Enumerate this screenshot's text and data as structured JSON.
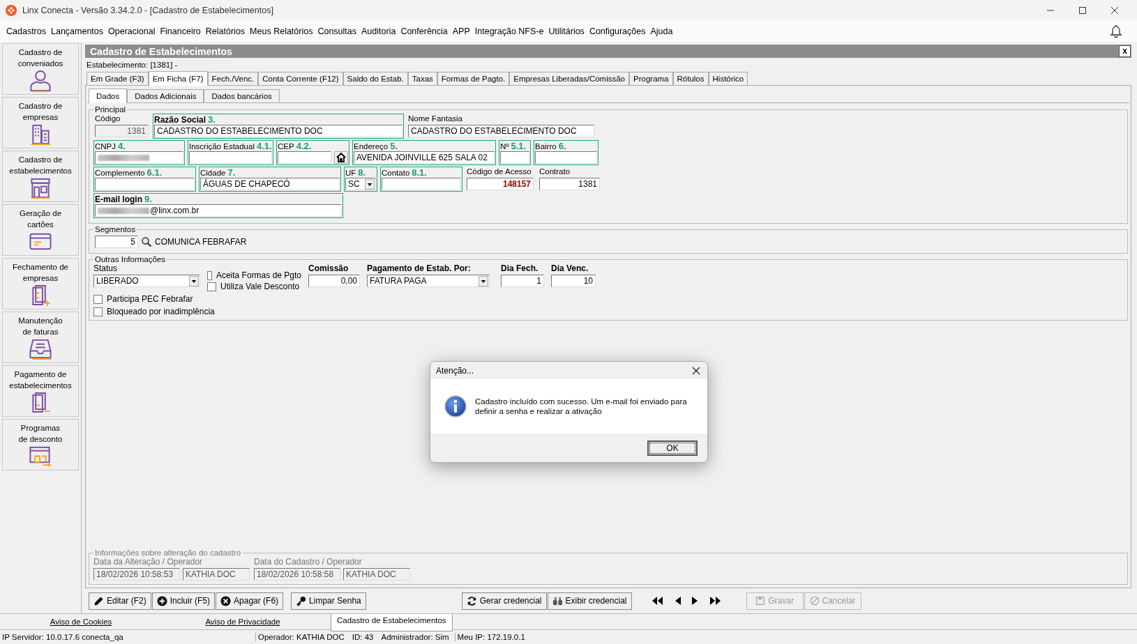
{
  "window": {
    "title": "Linx Conecta - Versão 3.34.2.0 - [Cadastro de Estabelecimentos]"
  },
  "menu": [
    "Cadastros",
    "Lançamentos",
    "Operacional",
    "Financeiro",
    "Relatórios",
    "Meus Relatórios",
    "Consultas",
    "Auditoria",
    "Conferência",
    "APP",
    "Integração NFS-e",
    "Utilitários",
    "Configurações",
    "Ajuda"
  ],
  "sidebar": {
    "items": [
      {
        "label": "Cadastro de\nconveniados",
        "selected": false
      },
      {
        "label": "Cadastro de\nempresas",
        "selected": false
      },
      {
        "label": "Cadastro de\nestabelecimentos",
        "selected": false
      },
      {
        "label": "Geração de\ncartões",
        "selected": false
      },
      {
        "label": "Fechamento de\nempresas",
        "selected": false
      },
      {
        "label": "Manutenção\nde faturas",
        "selected": false
      },
      {
        "label": "Pagamento de\nestabelecimentos",
        "selected": false
      },
      {
        "label": "Programas\nde desconto",
        "selected": false
      }
    ]
  },
  "panel": {
    "title": "Cadastro de Estabelecimentos",
    "close": "x",
    "record": "Estabelecimento: [1381] -"
  },
  "tabs": [
    {
      "label": "Em Grade (F3)",
      "selected": false
    },
    {
      "label": "Em Ficha (F7)",
      "selected": true
    },
    {
      "label": "Fech./Venc.",
      "selected": false
    },
    {
      "label": "Conta Corrente (F12)",
      "selected": false
    },
    {
      "label": "Saldo do Estab.",
      "selected": false
    },
    {
      "label": "Taxas",
      "selected": false
    },
    {
      "label": "Formas de Pagto.",
      "selected": false
    },
    {
      "label": "Empresas Liberadas/Comissão",
      "selected": false
    },
    {
      "label": "Programa",
      "selected": false
    },
    {
      "label": "Rótulos",
      "selected": false
    },
    {
      "label": "Histórico",
      "selected": false
    }
  ],
  "subtabs": [
    {
      "label": "Dados",
      "selected": true
    },
    {
      "label": "Dados Adicionais",
      "selected": false
    },
    {
      "label": "Dados bancários",
      "selected": false
    }
  ],
  "principal": {
    "title": "Principal",
    "lines": [
      {
        "fields": [
          {
            "label": "Código",
            "kind": "number",
            "value": "1381",
            "readonly": true,
            "highlighted": false
          },
          {
            "label": "Razão Social",
            "marker": "3.",
            "kind": "text",
            "value": "CADASTRO DO ESTABELECIMENTO DOC",
            "highlighted": true,
            "bold": true
          },
          {
            "label": "Nome Fantasia",
            "kind": "text",
            "value": "CADASTRO DO ESTABELECIMENTO DOC",
            "highlighted": false
          }
        ]
      },
      {
        "fields": [
          {
            "label": "CNPJ",
            "marker": "4.",
            "kind": "text",
            "redacted": true,
            "highlighted": true
          },
          {
            "label": "Inscrição Estadual",
            "marker": "4.1.",
            "kind": "text",
            "highlighted": true
          },
          {
            "label": "CEP",
            "marker": "4.2.",
            "kind": "lookup",
            "highlighted": true
          },
          {
            "label": "Endereço",
            "marker": "5.",
            "kind": "text",
            "value": "AVENIDA JOINVILLE 625 SALA 02",
            "highlighted": true
          },
          {
            "label": "Nº",
            "marker": "5.1.",
            "kind": "text",
            "highlighted": true
          },
          {
            "label": "Bairro",
            "marker": "6.",
            "kind": "text",
            "highlighted": true
          }
        ]
      },
      {
        "fields": [
          {
            "label": "Complemento",
            "marker": "6.1.",
            "kind": "text",
            "highlighted": true
          },
          {
            "label": "Cidade",
            "marker": "7.",
            "kind": "text",
            "value": "ÁGUAS DE CHAPECÓ",
            "highlighted": true
          },
          {
            "label": "UF",
            "marker": "8.",
            "kind": "select",
            "value": "SC",
            "highlighted": true
          },
          {
            "label": "Contato",
            "marker": "8.1.",
            "kind": "text",
            "highlighted": true
          },
          {
            "label": "Código de Acesso",
            "kind": "code",
            "value": "148157",
            "highlighted": false
          },
          {
            "label": "Contrato",
            "kind": "number",
            "value": "1381",
            "highlighted": false
          }
        ]
      },
      {
        "fields": [
          {
            "label": "E-mail login",
            "marker": "9.",
            "kind": "text",
            "value": "@linx.com.br",
            "redacted": true,
            "highlighted": true,
            "bold": true
          }
        ]
      }
    ]
  },
  "segmentos": {
    "title": "Segmentos",
    "code": "5",
    "name": "COMUNICA FEBRAFAR"
  },
  "outras": {
    "title": "Outras Informações",
    "status": {
      "label": "Status",
      "value": "LIBERADO"
    },
    "checkboxes": [
      {
        "label": "Aceita Formas de Pgto",
        "checked": false
      },
      {
        "label": "Utiliza Vale Desconto",
        "checked": false
      }
    ],
    "comissao": {
      "label": "Comissão",
      "value": "0,00"
    },
    "pagamento": {
      "label": "Pagamento de Estab. Por:",
      "value": "FATURA PAGA"
    },
    "dia_fech": {
      "label": "Dia Fech.",
      "value": "1"
    },
    "dia_venc": {
      "label": "Dia Venc.",
      "value": "10"
    },
    "flags": [
      {
        "label": "Participa PEC Febrafar",
        "checked": false
      },
      {
        "label": "Bloqueado por inadimplência",
        "checked": false
      }
    ]
  },
  "alteracao": {
    "title": "Informações sobre alteração do cadastro",
    "groups": [
      {
        "label": "Data da Alteração / Operador",
        "date": "18/02/2026 10:58:53",
        "operator": "KATHIA DOC"
      },
      {
        "label": "Data do Cadastro / Operador",
        "date": "18/02/2026 10:58:58",
        "operator": "KATHIA DOC"
      }
    ]
  },
  "buttons_left": [
    {
      "label": "Editar (F2)",
      "disabled": false
    },
    {
      "label": "Incluir (F5)",
      "disabled": false
    },
    {
      "label": "Apagar (F6)",
      "disabled": false
    },
    {
      "label": "Limpar Senha",
      "disabled": false
    }
  ],
  "buttons_mid": [
    {
      "label": "Gerar credencial",
      "disabled": false
    },
    {
      "label": "Exibir credencial",
      "disabled": false
    }
  ],
  "buttons_right": [
    {
      "label": "Gravar",
      "disabled": true
    },
    {
      "label": "Cancelar",
      "disabled": true
    }
  ],
  "bottom_tabs": [
    {
      "label": "Aviso de Cookies",
      "kind": "link"
    },
    {
      "label": "Aviso de Privacidade",
      "kind": "link"
    },
    {
      "label": "Cadastro de Estabelecimentos",
      "kind": "tab",
      "selected": true
    }
  ],
  "status_bar": [
    "IP Servidor: 10.0.17.6 conecta_qa",
    "Operador: KATHIA DOC",
    "ID: 43",
    "Administrador: Sim",
    "Meu IP: 172.19.0.1"
  ],
  "dialog": {
    "title": "Atenção...",
    "message": "Cadastro incluído com sucesso. Um e-mail foi enviado para definir a senha e realizar a ativação",
    "button": "OK"
  }
}
